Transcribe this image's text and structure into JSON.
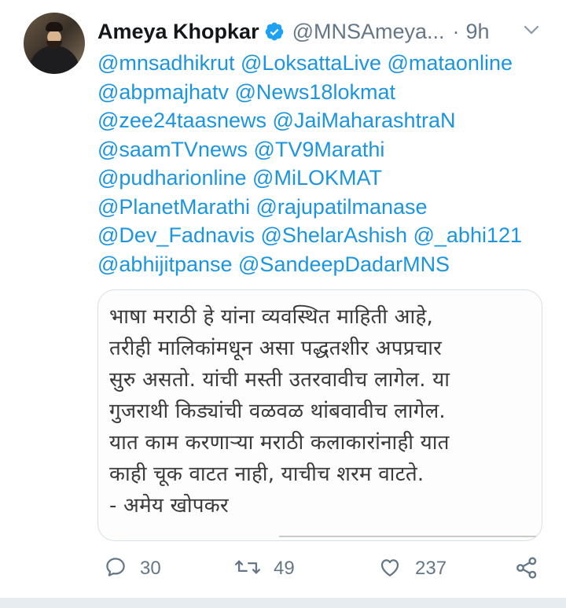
{
  "tweet": {
    "author_name": "Ameya Khopkar",
    "handle": "@MNSAmeya...",
    "separator": "·",
    "time": "9h",
    "mention_lines": [
      "@mnsadhikrut @LoksattaLive @mataonline",
      "@abpmajhatv @News18lokmat",
      "@zee24taasnews @JaiMaharashtraN",
      "@saamTVnews @TV9Marathi",
      "@pudharionline @MiLOKMAT",
      "@PlanetMarathi @rajupatilmanase",
      "@Dev_Fadnavis @ShelarAshish @_abhi121",
      "@abhijitpanse @SandeepDadarMNS"
    ],
    "image_text_lines": [
      "भाषा मराठी हे यांना व्यवस्थित माहिती आहे,",
      "तरीही मालिकांमधून असा पद्धतशीर अपप्रचार",
      "सुरु असतो. यांची मस्ती उतरवावीच लागेल. या",
      "गुजराथी किड्यांची वळवळ थांबवावीच लागेल.",
      "यात काम करणाऱ्या मराठी कलाकारांनाही यात",
      "काही चूक वाटत नाही, याचीच शरम वाटते.",
      "- अमेय खोपकर"
    ],
    "actions": {
      "reply_count": "30",
      "retweet_count": "49",
      "like_count": "237"
    }
  },
  "colors": {
    "link": "#1b95e0",
    "verified": "#1da1f2",
    "muted": "#657786",
    "border": "#d8dfe4"
  },
  "icons": [
    "verified-badge-icon",
    "chevron-down-icon",
    "reply-icon",
    "retweet-icon",
    "like-icon",
    "share-icon"
  ]
}
